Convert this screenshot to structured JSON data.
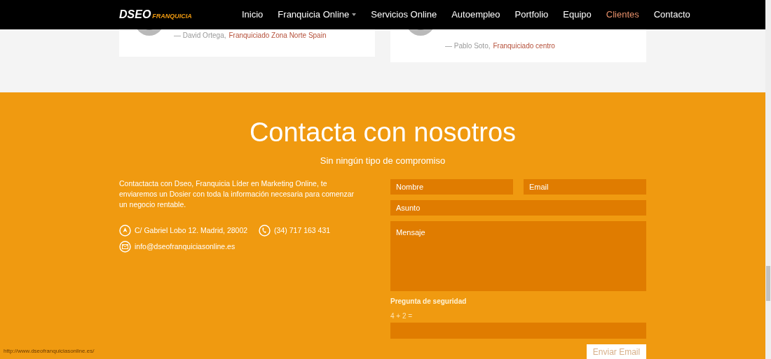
{
  "nav": {
    "logo_main": "DSEO",
    "logo_sub": "FRANQUICIA",
    "items": [
      {
        "label": "Inicio",
        "selected": false,
        "dropdown": false
      },
      {
        "label": "Franquicia Online",
        "selected": false,
        "dropdown": true
      },
      {
        "label": "Servicios Online",
        "selected": false,
        "dropdown": false
      },
      {
        "label": "Autoempleo",
        "selected": false,
        "dropdown": false
      },
      {
        "label": "Portfolio",
        "selected": false,
        "dropdown": false
      },
      {
        "label": "Equipo",
        "selected": false,
        "dropdown": false
      },
      {
        "label": "Clientes",
        "selected": true,
        "dropdown": false
      },
      {
        "label": "Contacto",
        "selected": false,
        "dropdown": false
      }
    ]
  },
  "testimonials": [
    {
      "author": "— David Ortega,",
      "role": "Franquiciado Zona Norte Spain"
    },
    {
      "author": "— Pablo Soto,",
      "role": "Franquiciado centro"
    }
  ],
  "contact": {
    "title": "Contacta con nosotros",
    "subtitle": "Sin ningún tipo de compromiso",
    "intro": "Contactacta con Dseo, Franquicia Líder en Marketing Online, te enviaremos un Dosier con toda la información necesaria para comenzar un negocio rentable.",
    "address": "C/ Gabriel Lobo 12. Madrid, 28002",
    "phone": "(34) 717 163 431",
    "email": "info@dseofranquiciasonline.es",
    "form": {
      "name_placeholder": "Nombre",
      "email_placeholder": "Email",
      "subject_placeholder": "Asunto",
      "message_placeholder": "Mensaje",
      "security_label": "Pregunta de seguridad",
      "security_question": "4 + 2 =",
      "submit": "Enviar Email"
    }
  },
  "status_url": "http://www.dseofranquiciasonline.es/"
}
